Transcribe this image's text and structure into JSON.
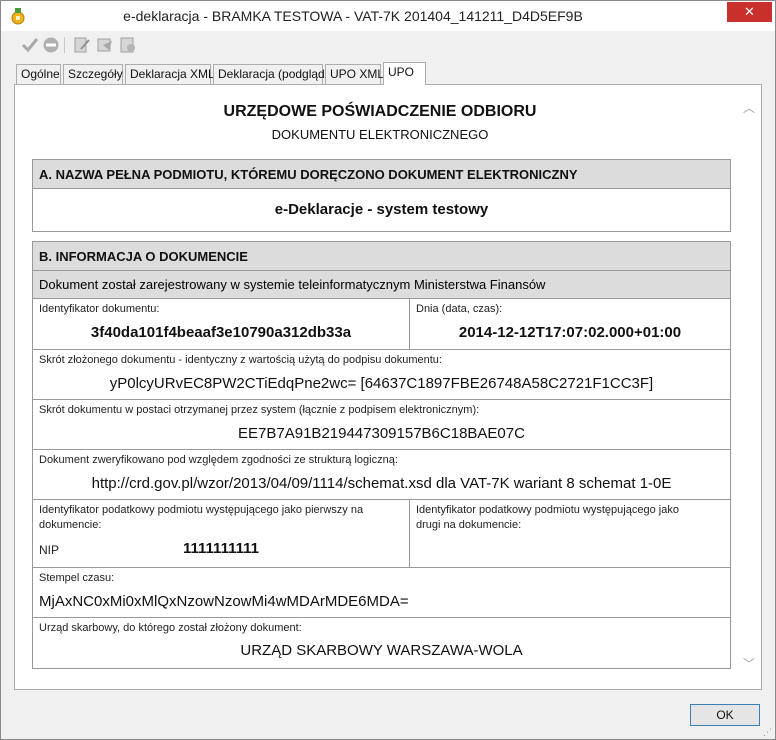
{
  "window": {
    "title": "e-deklaracja - BRAMKA TESTOWA - VAT-7K 201404_141211_D4D5EF9B",
    "close_label": "✕"
  },
  "toolbar": {
    "icons": [
      "checkmark-icon",
      "cancel-circle-icon",
      "edit-document-icon",
      "send-document-icon",
      "verify-document-icon"
    ]
  },
  "tabs": [
    {
      "label": "Ogólne"
    },
    {
      "label": "Szczegóły"
    },
    {
      "label": "Deklaracja XML"
    },
    {
      "label": "Deklaracja (podgląd)"
    },
    {
      "label": "UPO XML"
    },
    {
      "label": "UPO"
    }
  ],
  "active_tab": "UPO",
  "document": {
    "title": "URZĘDOWE POŚWIADCZENIE ODBIORU",
    "subtitle": "DOKUMENTU ELEKTRONICZNEGO",
    "section_a": {
      "heading": "A. NAZWA PEŁNA PODMIOTU, KTÓREMU DORĘCZONO DOKUMENT ELEKTRONICZNY",
      "value": "e-Deklaracje - system testowy"
    },
    "section_b": {
      "heading": "B. INFORMACJA O DOKUMENCIE",
      "registered_note": "Dokument został zarejestrowany w systemie teleinformatycznym Ministerstwa Finansów",
      "doc_id_label": "Identyfikator dokumentu:",
      "doc_id_value": "3f40da101f4beaaf3e10790a312db33a",
      "date_label": "Dnia (data, czas):",
      "date_value": "2014-12-12T17:07:02.000+01:00",
      "digest_label": "Skrót złożonego dokumentu - identyczny z wartością użytą do podpisu dokumentu:",
      "digest_value": "yP0lcyURvEC8PW2CTiEdqPne2wc= [64637C1897FBE26748A58C2721F1CC3F]",
      "received_digest_label": "Skrót dokumentu w postaci otrzymanej przez system (łącznie z podpisem elektronicznym):",
      "received_digest_value": "EE7B7A91B219447309157B6C18BAE07C",
      "schema_label": "Dokument zweryfikowano pod względem zgodności ze strukturą logiczną:",
      "schema_value": "http://crd.gov.pl/wzor/2013/04/09/1114/schemat.xsd dla VAT-7K wariant 8 schemat 1-0E",
      "taxpayer1_label_line1": "Identyfikator podatkowy podmiotu występującego jako pierwszy na",
      "taxpayer1_label_line2": "dokumencie:",
      "taxpayer1_type": "NIP",
      "taxpayer1_value": "1111111111",
      "taxpayer2_label_line1": "Identyfikator podatkowy podmiotu występującego jako",
      "taxpayer2_label_line2": "drugi na dokumencie:",
      "timestamp_label": "Stempel czasu:",
      "timestamp_value": "MjAxNC0xMi0xMlQxNzowNzowMi4wMDArMDE6MDA=",
      "office_label": "Urząd skarbowy, do którego został złożony dokument:",
      "office_value": "URZĄD SKARBOWY WARSZAWA-WOLA"
    }
  },
  "buttons": {
    "ok_label": "OK"
  }
}
